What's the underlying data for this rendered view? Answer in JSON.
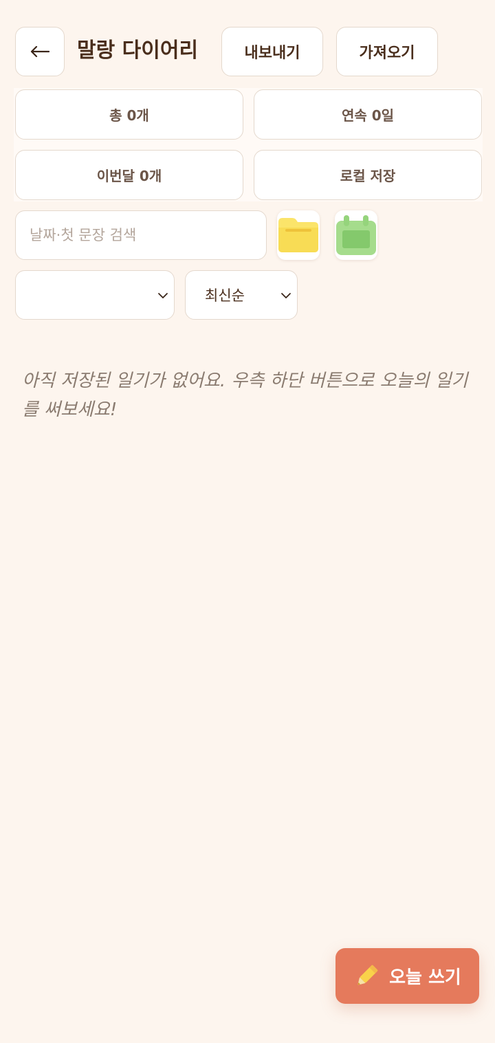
{
  "header": {
    "back_icon": "arrow-left-icon",
    "title": "말랑 다이어리",
    "export_label": "내보내기",
    "import_label": "가져오기"
  },
  "stats": {
    "total": "총 0개",
    "streak": "연속 0일",
    "this_month": "이번달 0개",
    "storage": "로컬 저장"
  },
  "search": {
    "placeholder": "날짜·첫 문장 검색",
    "value": ""
  },
  "toolbar": {
    "folder_icon": "folder-icon",
    "calendar_icon": "calendar-icon"
  },
  "filters": {
    "category_value": "",
    "sort_value": "최신순"
  },
  "empty_state": {
    "message": "아직 저장된 일기가 없어요. 우측 하단 버튼으로 오늘의 일기를 써보세요!"
  },
  "fab": {
    "icon": "pencil-icon",
    "label": "오늘 쓰기"
  },
  "colors": {
    "background": "#fdf5ee",
    "card": "#ffffff",
    "border": "#e4d8cd",
    "accent": "#e57a5c",
    "title_text": "#4a2e1c",
    "muted_text": "#8a7b70"
  }
}
